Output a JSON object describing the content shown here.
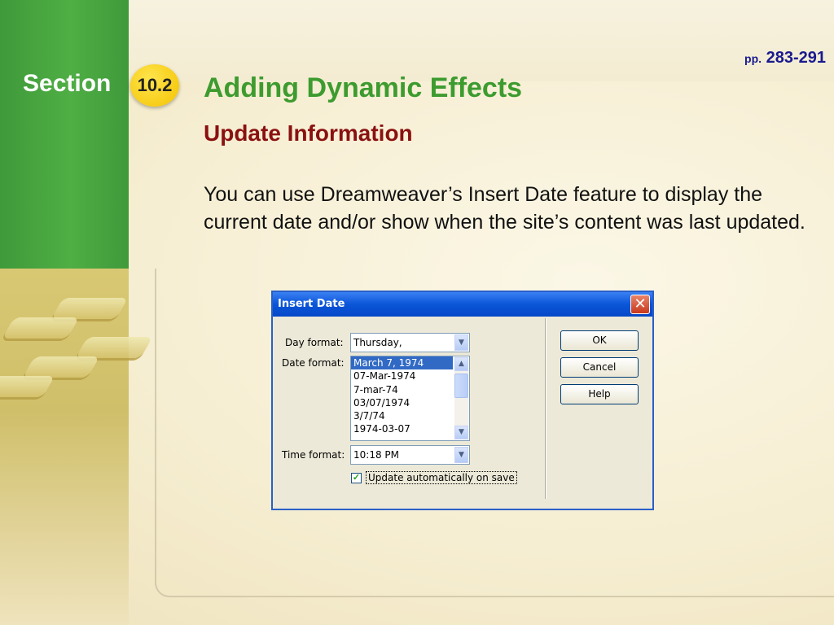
{
  "slide": {
    "section_label": "Section",
    "section_number": "10.2",
    "pages_prefix": "pp.",
    "pages_range": "283-291",
    "title": "Adding Dynamic Effects",
    "subtitle": "Update Information",
    "body": "You can use Dreamweaver’s Insert Date feature to display the current date and/or show when the site’s content was last updated."
  },
  "dialog": {
    "title": "Insert Date",
    "close_glyph": "✕",
    "day_format_label": "Day format:",
    "day_format_value": "Thursday,",
    "date_format_label": "Date format:",
    "date_formats": [
      "March 7, 1974",
      "07-Mar-1974",
      "7-mar-74",
      "03/07/1974",
      "3/7/74",
      "1974-03-07"
    ],
    "selected_date_format": "March 7, 1974",
    "time_format_label": "Time format:",
    "time_format_value": "10:18 PM",
    "checkbox_label": "Update automatically on save",
    "checkbox_checked": true,
    "buttons": {
      "ok": "OK",
      "cancel": "Cancel",
      "help": "Help"
    }
  },
  "colors": {
    "title_green": "#3d9b2f",
    "subtitle_red": "#8a1111",
    "pages_blue": "#1a1a8f",
    "badge_yellow": "#f3c200",
    "dialog_titlebar": "#0a55d8",
    "selection_blue": "#316ac5"
  }
}
